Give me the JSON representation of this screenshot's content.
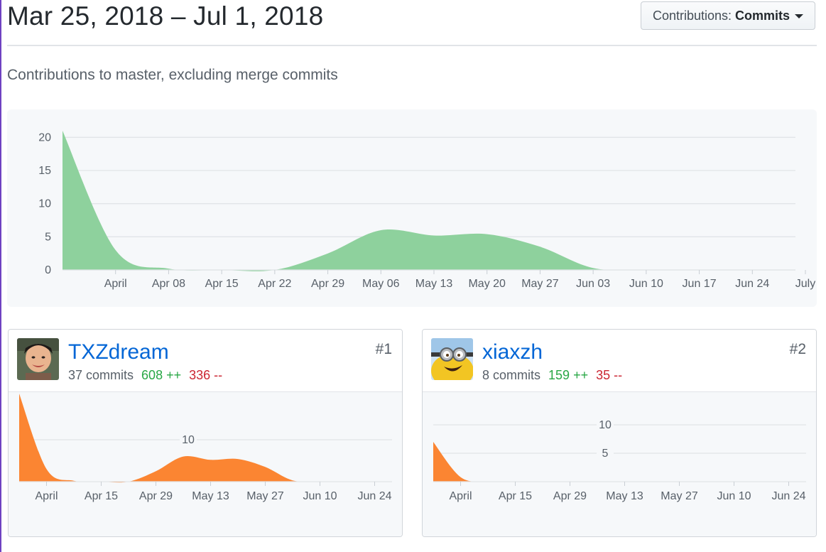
{
  "header": {
    "date_range": "Mar 25, 2018 – Jul 1, 2018",
    "filter_label": "Contributions:",
    "filter_value": "Commits",
    "subtitle": "Contributions to master, excluding merge commits"
  },
  "colors": {
    "main_area": "#8ed19d",
    "user_area": "#fb8532",
    "grid": "#e1e4e8",
    "axis_text": "#586069"
  },
  "chart_data": [
    {
      "type": "area",
      "title": "",
      "xlabel": "",
      "ylabel": "",
      "x_start": "2018-03-25",
      "x_end": "2018-07-01",
      "x_ticks": [
        "April",
        "Apr 08",
        "Apr 15",
        "Apr 22",
        "Apr 29",
        "May 06",
        "May 13",
        "May 20",
        "May 27",
        "Jun 03",
        "Jun 10",
        "Jun 17",
        "Jun 24",
        "July"
      ],
      "y_ticks": [
        0,
        5,
        10,
        15,
        20
      ],
      "ylim": [
        0,
        21
      ],
      "grid": true,
      "series": [
        {
          "x": [
            "2018-03-25",
            "2018-04-01",
            "2018-04-08",
            "2018-04-15",
            "2018-04-22",
            "2018-04-29",
            "2018-05-06",
            "2018-05-13",
            "2018-05-20",
            "2018-05-27",
            "2018-06-03",
            "2018-06-10",
            "2018-06-17",
            "2018-06-24",
            "2018-07-01"
          ],
          "values": [
            21,
            3,
            0.2,
            0,
            0,
            2.5,
            6,
            5.2,
            5.4,
            3.5,
            0.3,
            0,
            0,
            0,
            0
          ]
        }
      ]
    },
    {
      "type": "area",
      "title": "",
      "contributor": "TXZdream",
      "x_ticks": [
        "April",
        "Apr 15",
        "Apr 29",
        "May 13",
        "May 27",
        "Jun 10",
        "Jun 24"
      ],
      "y_ticks": [
        10
      ],
      "ylim": [
        0,
        20
      ],
      "grid": true,
      "series": [
        {
          "x": [
            "2018-03-25",
            "2018-04-01",
            "2018-04-08",
            "2018-04-15",
            "2018-04-22",
            "2018-04-29",
            "2018-05-06",
            "2018-05-13",
            "2018-05-20",
            "2018-05-27",
            "2018-06-03",
            "2018-06-10",
            "2018-06-17",
            "2018-06-24",
            "2018-07-01"
          ],
          "values": [
            21,
            3,
            0.2,
            0,
            0,
            2.5,
            6,
            5.2,
            5.4,
            3.5,
            0.3,
            0,
            0,
            0,
            0
          ]
        }
      ]
    },
    {
      "type": "area",
      "title": "",
      "contributor": "xiaxzh",
      "x_ticks": [
        "April",
        "Apr 15",
        "Apr 29",
        "May 13",
        "May 27",
        "Jun 10",
        "Jun 24"
      ],
      "y_ticks": [
        5,
        10
      ],
      "ylim": [
        0,
        12
      ],
      "grid": true,
      "series": [
        {
          "x": [
            "2018-03-25",
            "2018-04-01",
            "2018-04-08",
            "2018-04-15",
            "2018-04-22",
            "2018-04-29",
            "2018-05-06",
            "2018-05-13",
            "2018-05-20",
            "2018-05-27",
            "2018-06-03",
            "2018-06-10",
            "2018-06-17",
            "2018-06-24",
            "2018-07-01"
          ],
          "values": [
            7,
            0.8,
            0,
            0,
            0,
            0,
            0,
            0,
            0,
            0,
            0,
            0,
            0,
            0,
            0
          ]
        }
      ]
    }
  ],
  "contributors": [
    {
      "rank": "#1",
      "name": "TXZdream",
      "commits": "37 commits",
      "additions": "608 ++",
      "deletions": "336 --",
      "avatar": "boy-photo-icon"
    },
    {
      "rank": "#2",
      "name": "xiaxzh",
      "commits": "8 commits",
      "additions": "159 ++",
      "deletions": "35 --",
      "avatar": "minion-icon"
    }
  ]
}
